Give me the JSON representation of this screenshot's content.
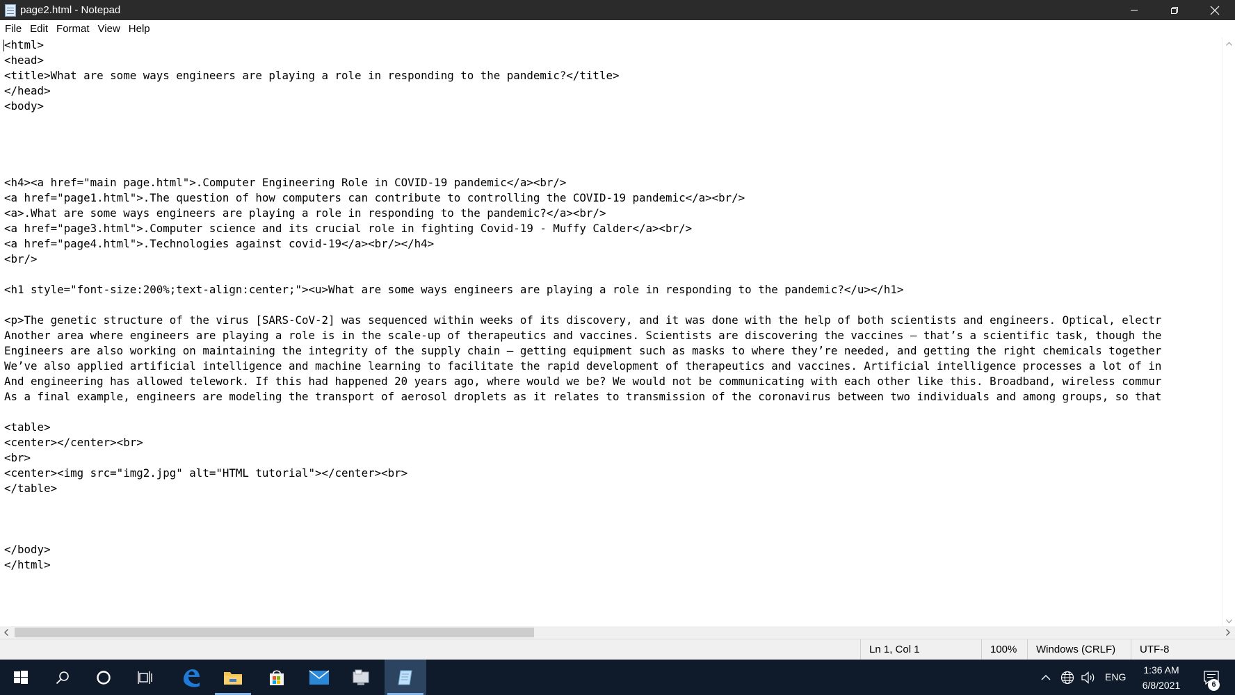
{
  "window": {
    "title": "page2.html - Notepad",
    "controls": {
      "minimize": "minimize",
      "maximize": "restore",
      "close": "close"
    }
  },
  "menu": {
    "items": [
      "File",
      "Edit",
      "Format",
      "View",
      "Help"
    ]
  },
  "editor": {
    "lines": [
      "<html>",
      "<head>",
      "<title>What are some ways engineers are playing a role in responding to the pandemic?</title>",
      "</head>",
      "<body>",
      "",
      "",
      "",
      "",
      "<h4><a href=\"main page.html\">.Computer Engineering Role in COVID-19 pandemic</a><br/>",
      "<a href=\"page1.html\">.The question of how computers can contribute to controlling the COVID-19 pandemic</a><br/>",
      "<a>.What are some ways engineers are playing a role in responding to the pandemic?</a><br/>",
      "<a href=\"page3.html\">.Computer science and its crucial role in fighting Covid-19 - Muffy Calder</a><br/>",
      "<a href=\"page4.html\">.Technologies against covid-19</a><br/></h4>",
      "<br/>",
      "",
      "<h1 style=\"font-size:200%;text-align:center;\"><u>What are some ways engineers are playing a role in responding to the pandemic?</u></h1>",
      "",
      "<p>The genetic structure of the virus [SARS-CoV-2] was sequenced within weeks of its discovery, and it was done with the help of both scientists and engineers. Optical, electr",
      "Another area where engineers are playing a role is in the scale-up of therapeutics and vaccines. Scientists are discovering the vaccines – that’s a scientific task, though the",
      "Engineers are also working on maintaining the integrity of the supply chain – getting equipment such as masks to where they’re needed, and getting the right chemicals together",
      "We’ve also applied artificial intelligence and machine learning to facilitate the rapid development of therapeutics and vaccines. Artificial intelligence processes a lot of in",
      "And engineering has allowed telework. If this had happened 20 years ago, where would we be? We would not be communicating with each other like this. Broadband, wireless commur",
      "As a final example, engineers are modeling the transport of aerosol droplets as it relates to transmission of the coronavirus between two individuals and among groups, so that",
      "",
      "<table>",
      "<center></center><br>",
      "<br>",
      "<center><img src=\"img2.jpg\" alt=\"HTML tutorial\"></center><br>",
      "</table>",
      "",
      "",
      "",
      "</body>",
      "</html>"
    ]
  },
  "status": {
    "position": "Ln 1, Col 1",
    "zoom": "100%",
    "line_ending": "Windows (CRLF)",
    "encoding": "UTF-8"
  },
  "taskbar": {
    "apps": [
      "start-icon",
      "search-icon",
      "cortana-icon",
      "task-view-icon",
      "edge-icon",
      "file-explorer-icon",
      "store-icon",
      "mail-icon",
      "app-icon",
      "notepad-icon"
    ],
    "tray": {
      "language": "ENG",
      "time": "1:36 AM",
      "date": "6/8/2021",
      "notifications": "6"
    }
  },
  "colors": {
    "titlebar": "#2b2b2b",
    "taskbar": "#0f1a2a",
    "active_task": "#2d4460",
    "edge_blue": "#1e7ad6",
    "folder_yellow": "#f2c14e"
  }
}
